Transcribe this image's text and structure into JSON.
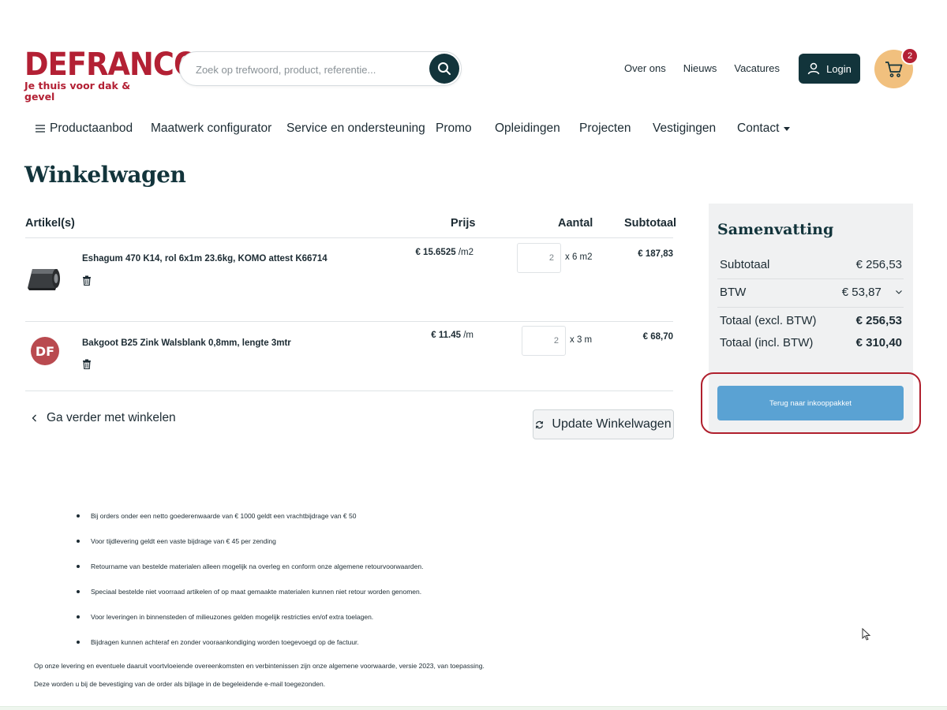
{
  "brand": {
    "logo_word": "DEFRANCQ",
    "tagline": "Je thuis voor dak & gevel",
    "accent_red": "#b32034",
    "dark_teal": "#12343b",
    "cart_bg": "#f1c07e",
    "button_blue": "#5aa2d3"
  },
  "search": {
    "placeholder": "Zoek op trefwoord, product, referentie..."
  },
  "top_links": [
    "Over ons",
    "Nieuws",
    "Vacatures"
  ],
  "login_label": "Login",
  "cart_count": "2",
  "nav": [
    "Productaanbod",
    "Maatwerk configurator",
    "Service en ondersteuning",
    "Promo",
    "Opleidingen",
    "Projecten",
    "Vestigingen",
    "Contact"
  ],
  "page_title": "Winkelwagen",
  "table": {
    "headers": {
      "article": "Artikel(s)",
      "price": "Prijs",
      "qty": "Aantal",
      "subtotal": "Subtotaal"
    },
    "rows": [
      {
        "name": "Eshagum 470 K14, rol 6x1m 23.6kg, KOMO attest K66714",
        "thumb": "roofing-roll-image",
        "price": "€ 15.6525",
        "price_unit": "/m2",
        "qty": "2",
        "qty_unit": "x 6 m2",
        "subtotal": "€ 187,83"
      },
      {
        "name": "Bakgoot B25 Zink Walsblank 0,8mm, lengte 3mtr",
        "thumb": "df-placeholder-logo",
        "thumb_text": "DF",
        "price": "€ 11.45",
        "price_unit": "/m",
        "qty": "2",
        "qty_unit": "x 3 m",
        "subtotal": "€ 68,70"
      }
    ]
  },
  "continue_label": "Ga verder met winkelen",
  "update_label": "Update Winkelwagen",
  "summary": {
    "title": "Samenvatting",
    "subtotal_label": "Subtotaal",
    "subtotal_value": "€ 256,53",
    "btw_label": "BTW",
    "btw_value": "€ 53,87",
    "excl_label": "Totaal (excl. BTW)",
    "excl_value": "€ 256,53",
    "incl_label": "Totaal (incl. BTW)",
    "incl_value": "€ 310,40",
    "back_button": "Terug naar inkooppakket"
  },
  "notes": [
    "Bij orders onder een netto goederenwaarde van € 1000 geldt een vrachtbijdrage van € 50",
    "Voor tijdlevering geldt een vaste bijdrage van € 45 per zending",
    "Retourname van bestelde materialen alleen mogelijk na overleg en conform onze algemene retourvoorwaarden.",
    "Speciaal bestelde niet voorraad artikelen of op maat gemaakte materialen kunnen niet retour worden genomen.",
    "Voor leveringen in binnensteden of milieuzones gelden mogelijk restricties en/of extra toelagen.",
    "Bijdragen kunnen achteraf en zonder vooraankondiging worden toegevoegd op de factuur."
  ],
  "legal": [
    "Op onze levering en eventuele daaruit voortvloeiende overeenkomsten en verbintenissen zijn onze algemene voorwaarde, versie 2023, van toepassing.",
    "Deze worden u bij de bevestiging van de order als bijlage in de begeleidende e-mail toegezonden."
  ]
}
